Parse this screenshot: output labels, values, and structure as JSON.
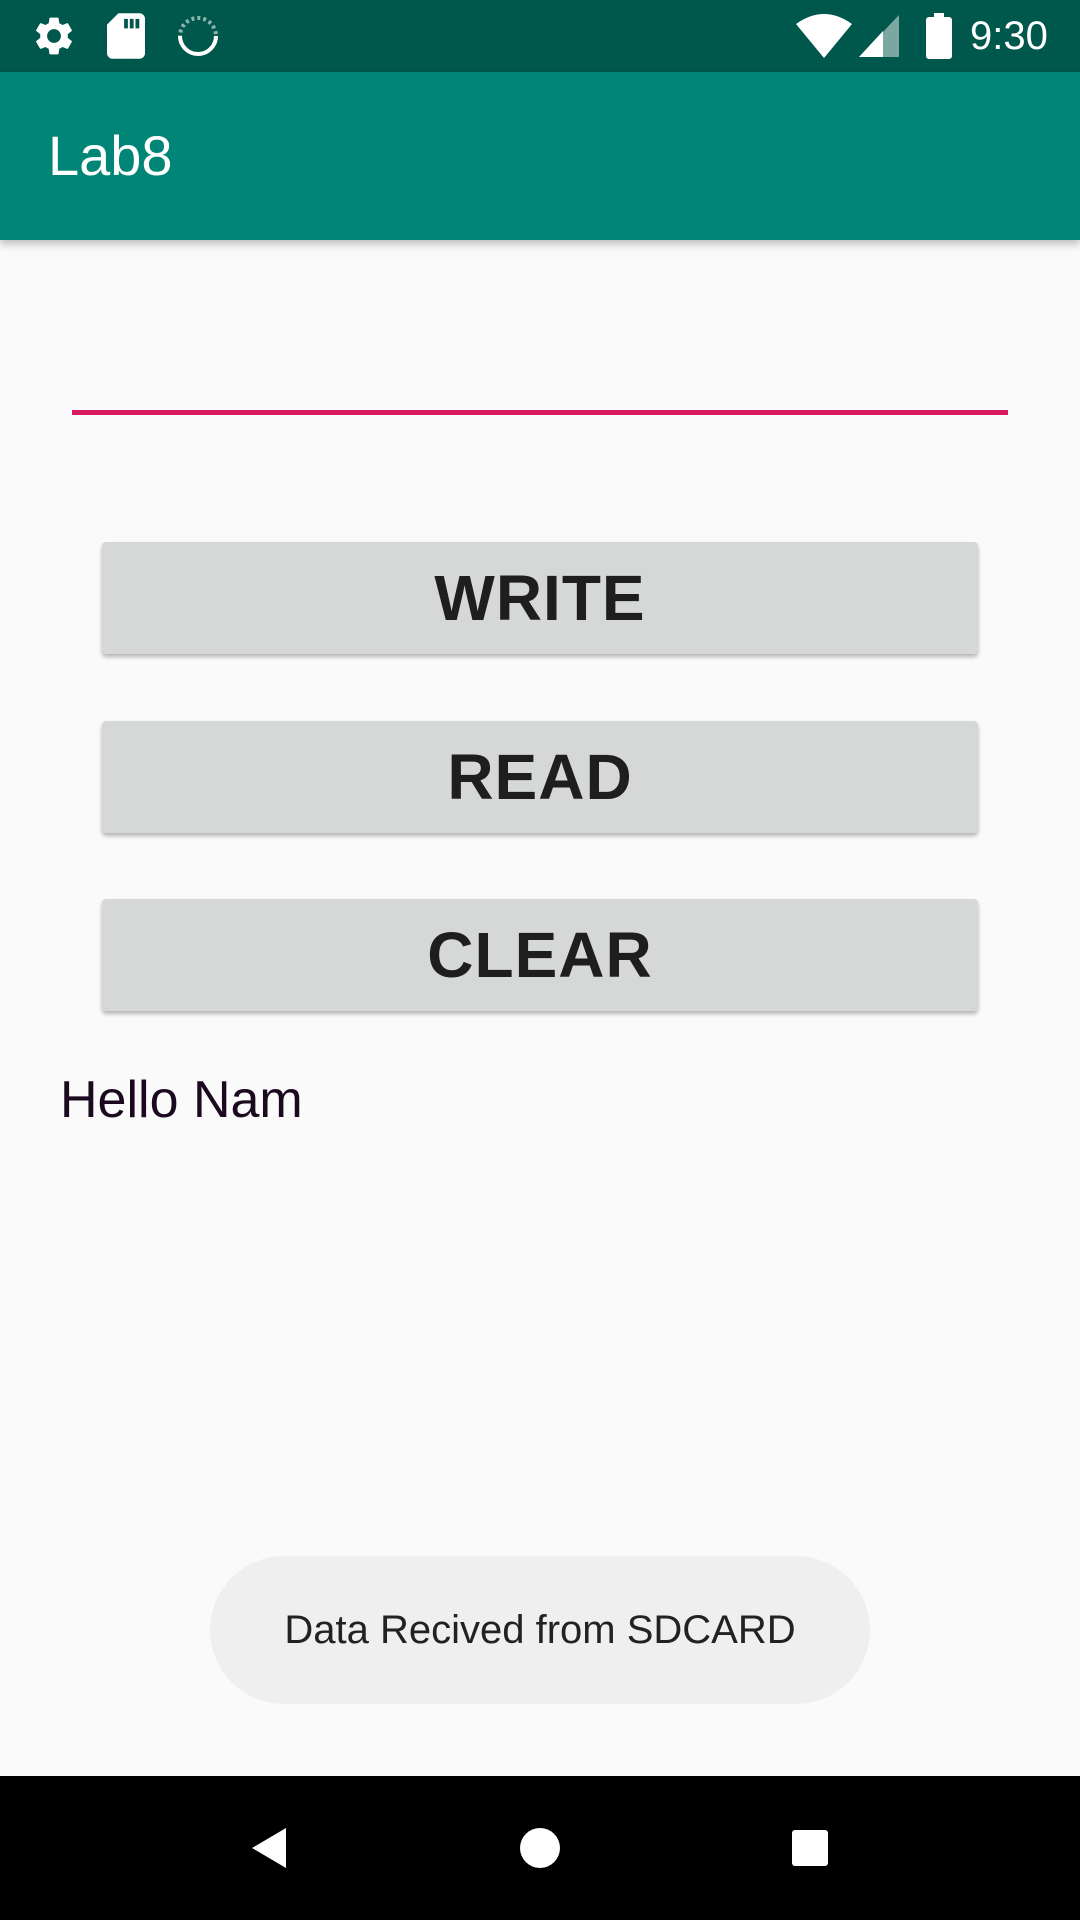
{
  "status_bar": {
    "time": "9:30",
    "icons": [
      "gear-icon",
      "sd-card-icon",
      "sync-spinner-icon",
      "wifi-icon",
      "cell-signal-icon",
      "battery-icon"
    ],
    "color": "#00574b"
  },
  "app_bar": {
    "title": "Lab8",
    "color": "#008577"
  },
  "input": {
    "value": "",
    "placeholder": "",
    "underline_color": "#d81b60"
  },
  "buttons": {
    "write": "WRITE",
    "read": "READ",
    "clear": "CLEAR"
  },
  "output": {
    "text": "Hello Nam"
  },
  "toast": {
    "message": "Data Recived from SDCARD"
  },
  "nav_bar": {
    "icons": [
      "back-icon",
      "home-icon",
      "recents-icon"
    ]
  }
}
